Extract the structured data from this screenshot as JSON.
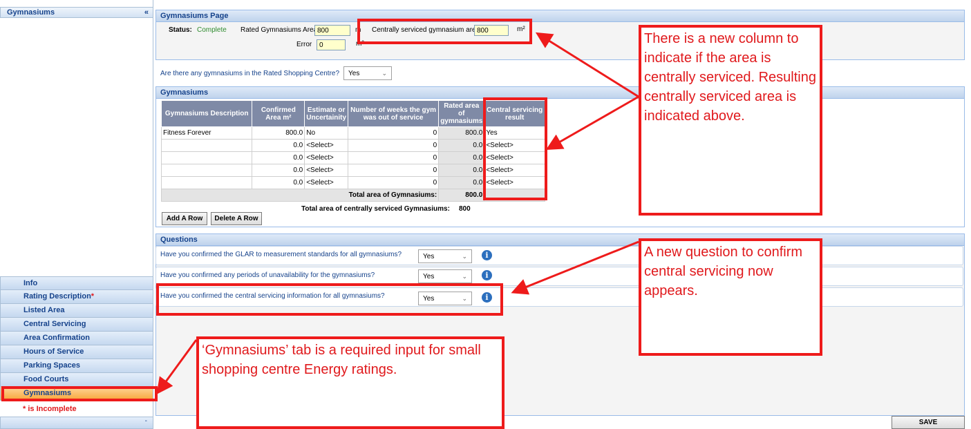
{
  "sidebar": {
    "title": "Gymnasiums",
    "collapse_icon": "«",
    "items": [
      {
        "label": "Info",
        "required": ""
      },
      {
        "label": "Rating Description",
        "required": "*"
      },
      {
        "label": "Listed Area",
        "required": ""
      },
      {
        "label": "Central Servicing",
        "required": ""
      },
      {
        "label": "Area Confirmation",
        "required": ""
      },
      {
        "label": "Hours of Service",
        "required": ""
      },
      {
        "label": "Parking Spaces",
        "required": ""
      },
      {
        "label": "Food Courts",
        "required": ""
      },
      {
        "label": "Gymnasiums",
        "required": ""
      }
    ],
    "incomplete_note": "* is Incomplete",
    "bottom_marker": "-"
  },
  "page": {
    "title": "Gymnasiums Page",
    "status_label": "Status:",
    "status_value": "Complete",
    "rated_area_label": "Rated Gymnasiums Area",
    "rated_area_value": "800",
    "rated_area_unit": "m",
    "central_area_label": "Centrally serviced gymnasium area",
    "central_area_value": "800",
    "central_area_unit": "m²",
    "error_label": "Error",
    "error_value": "0",
    "error_unit": "m²",
    "question_label": "Are there any gymnasiums in the Rated Shopping Centre?",
    "question_value": "Yes"
  },
  "gym_panel": {
    "title": "Gymnasiums",
    "columns": [
      "Gymnasiums Description",
      "Confirmed Area m²",
      "Estimate or Uncertainity",
      "Number of weeks the gym was out of service",
      "Rated area of gymnasiums",
      "Central servicing result"
    ],
    "rows": [
      {
        "desc": "Fitness Forever",
        "area": "800.0",
        "estimate": "No",
        "weeks": "0",
        "rated": "800.0",
        "central": "Yes"
      },
      {
        "desc": "",
        "area": "0.0",
        "estimate": "<Select>",
        "weeks": "0",
        "rated": "0.0",
        "central": "<Select>"
      },
      {
        "desc": "",
        "area": "0.0",
        "estimate": "<Select>",
        "weeks": "0",
        "rated": "0.0",
        "central": "<Select>"
      },
      {
        "desc": "",
        "area": "0.0",
        "estimate": "<Select>",
        "weeks": "0",
        "rated": "0.0",
        "central": "<Select>"
      },
      {
        "desc": "",
        "area": "0.0",
        "estimate": "<Select>",
        "weeks": "0",
        "rated": "0.0",
        "central": "<Select>"
      }
    ],
    "total_label": "Total area of Gymnasiums:",
    "total_value": "800.0",
    "central_total_label": "Total area of centrally serviced Gymnasiums:",
    "central_total_value": "800",
    "add_row": "Add A Row",
    "delete_row": "Delete A Row"
  },
  "questions": {
    "title": "Questions",
    "items": [
      {
        "text": "Have you confirmed the GLAR to measurement standards for all gymnasiums?",
        "answer": "Yes"
      },
      {
        "text": "Have you confirmed any periods of unavailability for the gymnasiums?",
        "answer": "Yes"
      },
      {
        "text": "Have you confirmed the central servicing information for all gymnasiums?",
        "answer": "Yes"
      }
    ]
  },
  "save_label": "SAVE",
  "annotations": {
    "note1": "There is a new column to indicate if the area is centrally serviced. Resulting centrally serviced area is indicated above.",
    "note2": "A new question to confirm central servicing now appears.",
    "note3": "‘Gymnasiums’ tab is a required input for small shopping centre Energy ratings."
  },
  "colors": {
    "accent": "#15428b",
    "annotation": "#ee1b1b",
    "active_tab": "#f7a63c"
  }
}
